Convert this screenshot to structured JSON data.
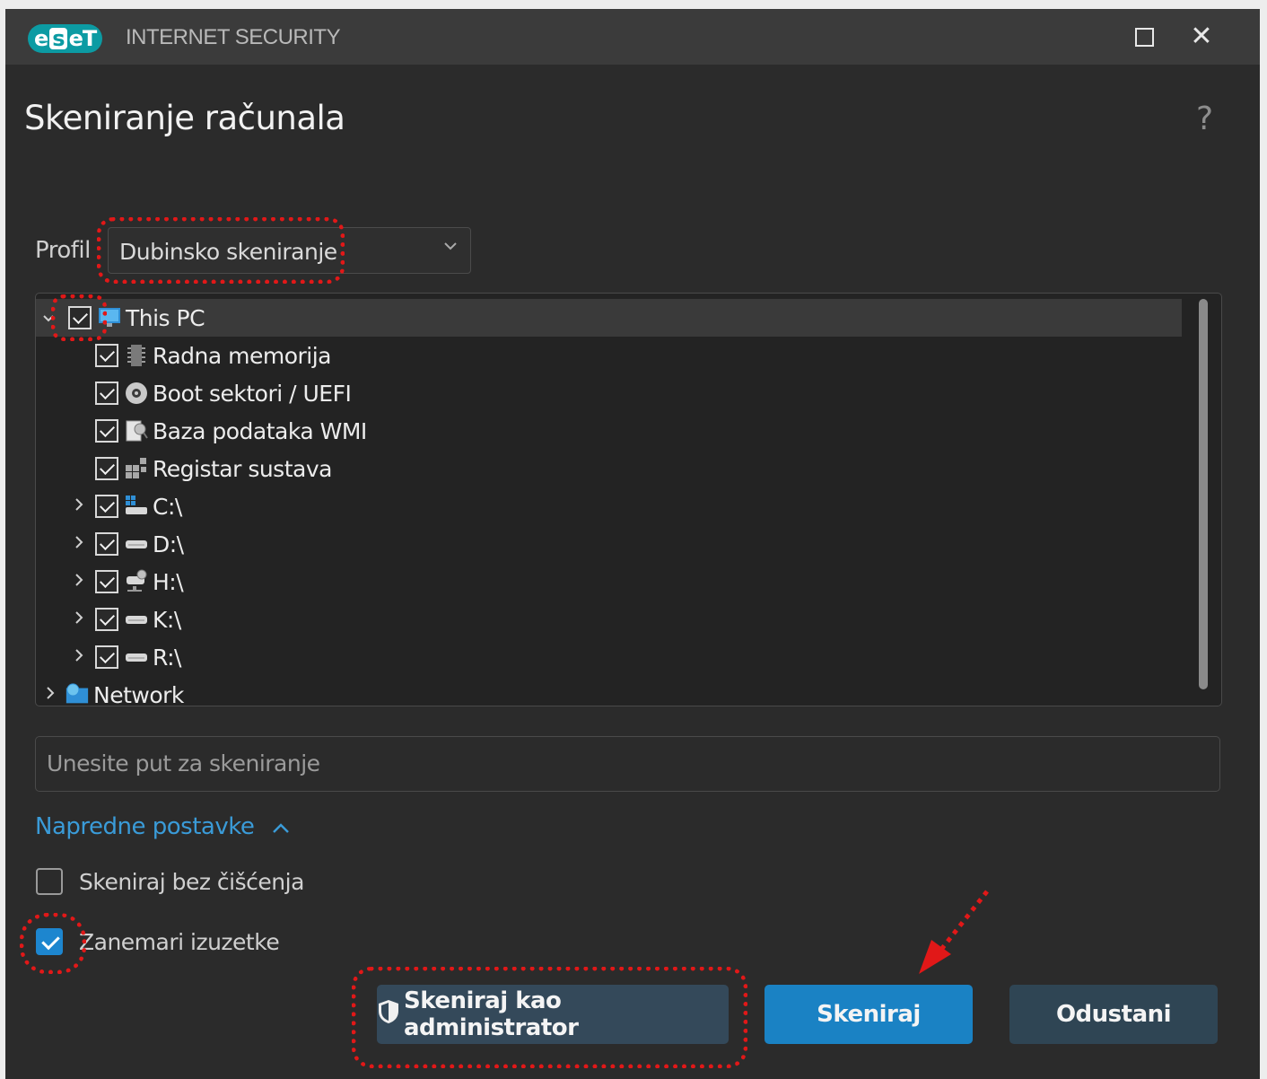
{
  "window": {
    "logo_text_a": "e",
    "logo_text_b": "s",
    "logo_text_c": "eT",
    "product_name": "INTERNET SECURITY",
    "maximize_icon": "maximize-icon",
    "close_glyph": "✕"
  },
  "page": {
    "title": "Skeniranje računala",
    "help_glyph": "?"
  },
  "profile": {
    "label": "Profil",
    "selected": "Dubinsko skeniranje"
  },
  "tree": {
    "items": [
      {
        "label": "This PC",
        "icon": "monitor-icon",
        "expander": "⌄",
        "checked": true
      },
      {
        "label": "Radna memorija",
        "icon": "memory-chip-icon",
        "checked": true
      },
      {
        "label": "Boot sektori / UEFI",
        "icon": "disc-icon",
        "checked": true
      },
      {
        "label": "Baza podataka WMI",
        "icon": "wmi-database-icon",
        "checked": true
      },
      {
        "label": "Registar sustava",
        "icon": "registry-icon",
        "checked": true
      },
      {
        "label": "C:\\",
        "icon": "system-drive-icon",
        "expander": "›",
        "checked": true
      },
      {
        "label": "D:\\",
        "icon": "drive-icon",
        "expander": "›",
        "checked": true
      },
      {
        "label": "H:\\",
        "icon": "network-drive-icon",
        "expander": "›",
        "checked": true
      },
      {
        "label": "K:\\",
        "icon": "drive-icon",
        "expander": "›",
        "checked": true
      },
      {
        "label": "R:\\",
        "icon": "drive-icon",
        "expander": "›",
        "checked": true
      },
      {
        "label": "Network",
        "icon": "network-icon",
        "expander": "›"
      }
    ]
  },
  "path_input": {
    "placeholder": "Unesite put za skeniranje"
  },
  "advanced": {
    "label": "Napredne postavke",
    "chevron": "^"
  },
  "options": [
    {
      "label": "Skeniraj bez čišćenja",
      "checked": false
    },
    {
      "label": "Zanemari izuzetke",
      "checked": true
    }
  ],
  "buttons": {
    "admin": "Skeniraj kao administrator",
    "scan": "Skeniraj",
    "cancel": "Odustani"
  },
  "colors": {
    "accent": "#1a82c4",
    "link": "#3a9bd8",
    "annotation": "#e11818"
  }
}
